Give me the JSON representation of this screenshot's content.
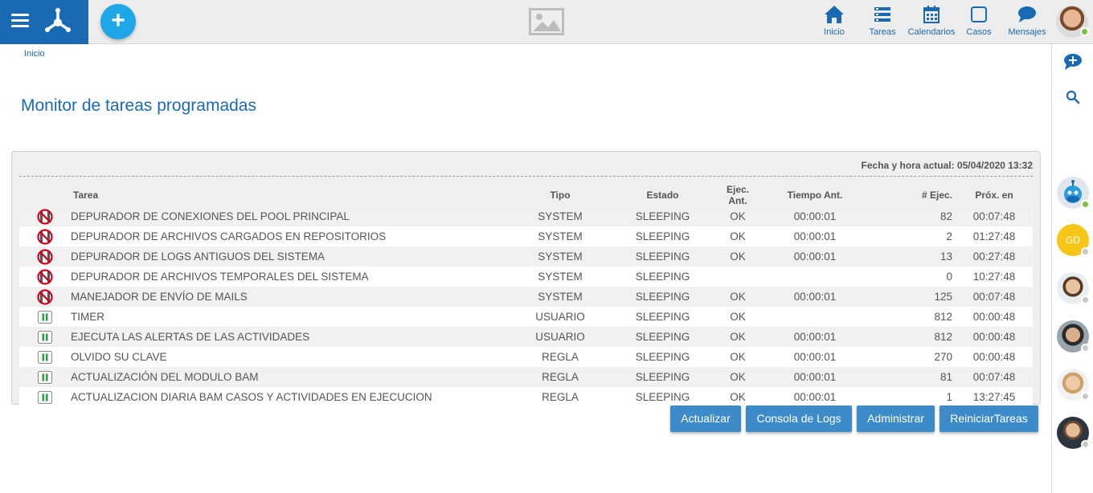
{
  "header": {
    "nav": [
      {
        "label": "Inicio",
        "icon": "home-icon"
      },
      {
        "label": "Tareas",
        "icon": "tasks-icon"
      },
      {
        "label": "Calendarios",
        "icon": "calendar-icon"
      },
      {
        "label": "Casos",
        "icon": "cases-icon"
      },
      {
        "label": "Mensajes",
        "icon": "messages-icon"
      }
    ],
    "add_label": "+"
  },
  "breadcrumb": "Inicio",
  "page_title": "Monitor de tareas programadas",
  "datetime": "Fecha y hora actual: 05/04/2020 13:32",
  "table": {
    "headers": {
      "tarea": "Tarea",
      "tipo": "Tipo",
      "estado": "Estado",
      "ejec_ant": "Ejec. Ant.",
      "tiempo_ant": "Tiempo Ant.",
      "num_ejec": "# Ejec.",
      "prox_en": "Próx. en"
    },
    "rows": [
      {
        "icon": "stopped",
        "tarea": "DEPURADOR DE CONEXIONES DEL POOL PRINCIPAL",
        "tipo": "SYSTEM",
        "estado": "SLEEPING",
        "ejec_ant": "OK",
        "tiempo_ant": "00:00:01",
        "num_ejec": "82",
        "prox_en": "00:07:48"
      },
      {
        "icon": "stopped",
        "tarea": "DEPURADOR DE ARCHIVOS CARGADOS EN REPOSITORIOS",
        "tipo": "SYSTEM",
        "estado": "SLEEPING",
        "ejec_ant": "OK",
        "tiempo_ant": "00:00:01",
        "num_ejec": "2",
        "prox_en": "01:27:48"
      },
      {
        "icon": "stopped",
        "tarea": "DEPURADOR DE LOGS ANTIGUOS DEL SISTEMA",
        "tipo": "SYSTEM",
        "estado": "SLEEPING",
        "ejec_ant": "OK",
        "tiempo_ant": "00:00:01",
        "num_ejec": "13",
        "prox_en": "00:27:48"
      },
      {
        "icon": "stopped",
        "tarea": "DEPURADOR DE ARCHIVOS TEMPORALES DEL SISTEMA",
        "tipo": "SYSTEM",
        "estado": "SLEEPING",
        "ejec_ant": "",
        "tiempo_ant": "",
        "num_ejec": "0",
        "prox_en": "10:27:48"
      },
      {
        "icon": "stopped",
        "tarea": "MANEJADOR DE ENVÍO DE MAILS",
        "tipo": "SYSTEM",
        "estado": "SLEEPING",
        "ejec_ant": "OK",
        "tiempo_ant": "00:00:01",
        "num_ejec": "125",
        "prox_en": "00:07:48"
      },
      {
        "icon": "pause",
        "tarea": "TIMER",
        "tipo": "USUARIO",
        "estado": "SLEEPING",
        "ejec_ant": "OK",
        "tiempo_ant": "",
        "num_ejec": "812",
        "prox_en": "00:00:48"
      },
      {
        "icon": "pause",
        "tarea": "EJECUTA LAS ALERTAS DE LAS ACTIVIDADES",
        "tipo": "USUARIO",
        "estado": "SLEEPING",
        "ejec_ant": "OK",
        "tiempo_ant": "00:00:01",
        "num_ejec": "812",
        "prox_en": "00:00:48"
      },
      {
        "icon": "pause",
        "tarea": "OLVIDO SU CLAVE",
        "tipo": "REGLA",
        "estado": "SLEEPING",
        "ejec_ant": "OK",
        "tiempo_ant": "00:00:01",
        "num_ejec": "270",
        "prox_en": "00:00:48"
      },
      {
        "icon": "pause",
        "tarea": "ACTUALIZACIÓN DEL MODULO BAM",
        "tipo": "REGLA",
        "estado": "SLEEPING",
        "ejec_ant": "OK",
        "tiempo_ant": "00:00:01",
        "num_ejec": "81",
        "prox_en": "00:07:48"
      },
      {
        "icon": "pause",
        "tarea": "ACTUALIZACION DIARIA BAM CASOS Y ACTIVIDADES EN EJECUCION",
        "tipo": "REGLA",
        "estado": "SLEEPING",
        "ejec_ant": "OK",
        "tiempo_ant": "00:00:01",
        "num_ejec": "1",
        "prox_en": "13:27:45"
      }
    ]
  },
  "buttons": {
    "actualizar": "Actualizar",
    "consola": "Consola de Logs",
    "administrar": "Administrar",
    "reiniciar": "ReiniciarTareas"
  },
  "sidebar": {
    "contacts": [
      {
        "name": "bot",
        "initials": "",
        "status": "online"
      },
      {
        "name": "gd",
        "initials": "GD",
        "status": "offline"
      },
      {
        "name": "user-3",
        "initials": "",
        "status": "offline"
      },
      {
        "name": "user-4",
        "initials": "",
        "status": "offline"
      },
      {
        "name": "user-5",
        "initials": "",
        "status": "offline"
      },
      {
        "name": "user-6",
        "initials": "",
        "status": "offline"
      }
    ]
  },
  "colors": {
    "brand": "#1a6ab3",
    "accent": "#1ea7e8",
    "button": "#3e8bc9",
    "stopped": "#d0021b",
    "pause": "#2e9e4a",
    "online": "#7cc242"
  }
}
